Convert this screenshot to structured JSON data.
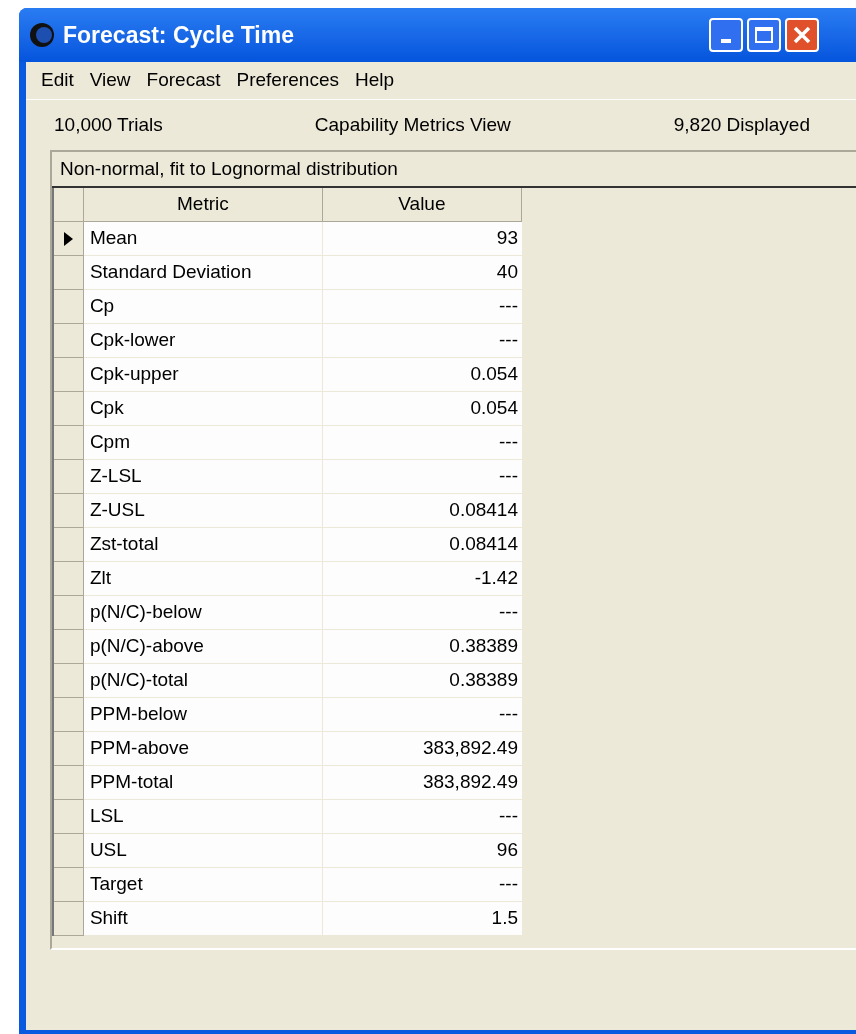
{
  "window": {
    "title": "Forecast: Cycle Time"
  },
  "menu": [
    "Edit",
    "View",
    "Forecast",
    "Preferences",
    "Help"
  ],
  "info": {
    "trials": "10,000 Trials",
    "view": "Capability Metrics View",
    "displayed": "9,820 Displayed"
  },
  "panel": {
    "caption": "Non-normal, fit to Lognormal distribution"
  },
  "table": {
    "columns": [
      "Metric",
      "Value"
    ],
    "rows": [
      {
        "metric": "Mean",
        "value": "93",
        "selected": true
      },
      {
        "metric": "Standard Deviation",
        "value": "40",
        "selected": false
      },
      {
        "metric": "Cp",
        "value": "---",
        "selected": false
      },
      {
        "metric": "Cpk-lower",
        "value": "---",
        "selected": false
      },
      {
        "metric": "Cpk-upper",
        "value": "0.054",
        "selected": false
      },
      {
        "metric": "Cpk",
        "value": "0.054",
        "selected": false
      },
      {
        "metric": "Cpm",
        "value": "---",
        "selected": false
      },
      {
        "metric": "Z-LSL",
        "value": "---",
        "selected": false
      },
      {
        "metric": "Z-USL",
        "value": "0.08414",
        "selected": false
      },
      {
        "metric": "Zst-total",
        "value": "0.08414",
        "selected": false
      },
      {
        "metric": "Zlt",
        "value": "-1.42",
        "selected": false
      },
      {
        "metric": "p(N/C)-below",
        "value": "---",
        "selected": false
      },
      {
        "metric": "p(N/C)-above",
        "value": "0.38389",
        "selected": false
      },
      {
        "metric": "p(N/C)-total",
        "value": "0.38389",
        "selected": false
      },
      {
        "metric": "PPM-below",
        "value": "---",
        "selected": false
      },
      {
        "metric": "PPM-above",
        "value": "383,892.49",
        "selected": false
      },
      {
        "metric": "PPM-total",
        "value": "383,892.49",
        "selected": false
      },
      {
        "metric": "LSL",
        "value": "---",
        "selected": false
      },
      {
        "metric": "USL",
        "value": "96",
        "selected": false
      },
      {
        "metric": "Target",
        "value": "---",
        "selected": false
      },
      {
        "metric": "Shift",
        "value": "1.5",
        "selected": false
      }
    ]
  }
}
